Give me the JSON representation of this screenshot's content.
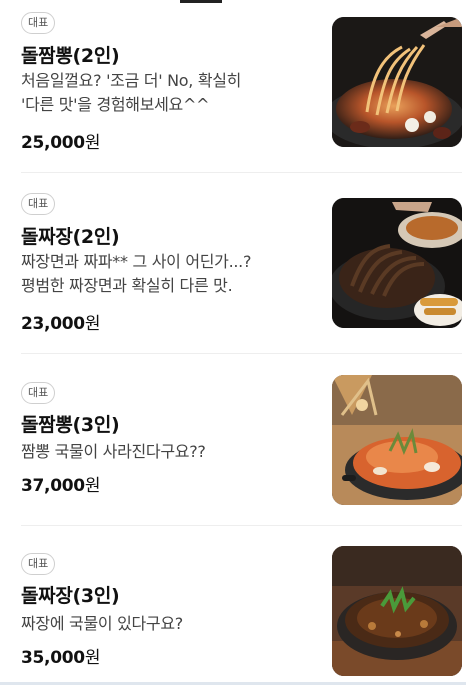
{
  "menu": {
    "items": [
      {
        "badge": "대표",
        "name": "돌짬뽕(2인)",
        "desc_line1": "처음일껄요? '조금 더' No, 확실히",
        "desc_line2": "'다른 맛'을 경험해보세요^^",
        "price": "25,000",
        "currency": "원",
        "image_icon": "jjamppong-noodles-photo"
      },
      {
        "badge": "대표",
        "name": "돌짜장(2인)",
        "desc_line1": "짜장면과 짜파** 그 사이 어딘가...?",
        "desc_line2": "평범한 짜장면과 확실히 다른 맛.",
        "price": "23,000",
        "currency": "원",
        "image_icon": "jjajang-noodles-photo"
      },
      {
        "badge": "대표",
        "name": "돌짬뽕(3인)",
        "desc_line1": "짬뽕 국물이 사라진다구요??",
        "desc_line2": "",
        "price": "37,000",
        "currency": "원",
        "image_icon": "jjamppong-stone-pot-photo"
      },
      {
        "badge": "대표",
        "name": "돌짜장(3인)",
        "desc_line1": "짜장에 국물이 있다구요?",
        "desc_line2": "",
        "price": "35,000",
        "currency": "원",
        "image_icon": "jjajang-stone-pot-photo"
      }
    ]
  },
  "colors": {
    "text_primary": "#111111",
    "text_secondary": "#444444",
    "badge_border": "#cfcfcf",
    "divider": "#eeeeee"
  }
}
